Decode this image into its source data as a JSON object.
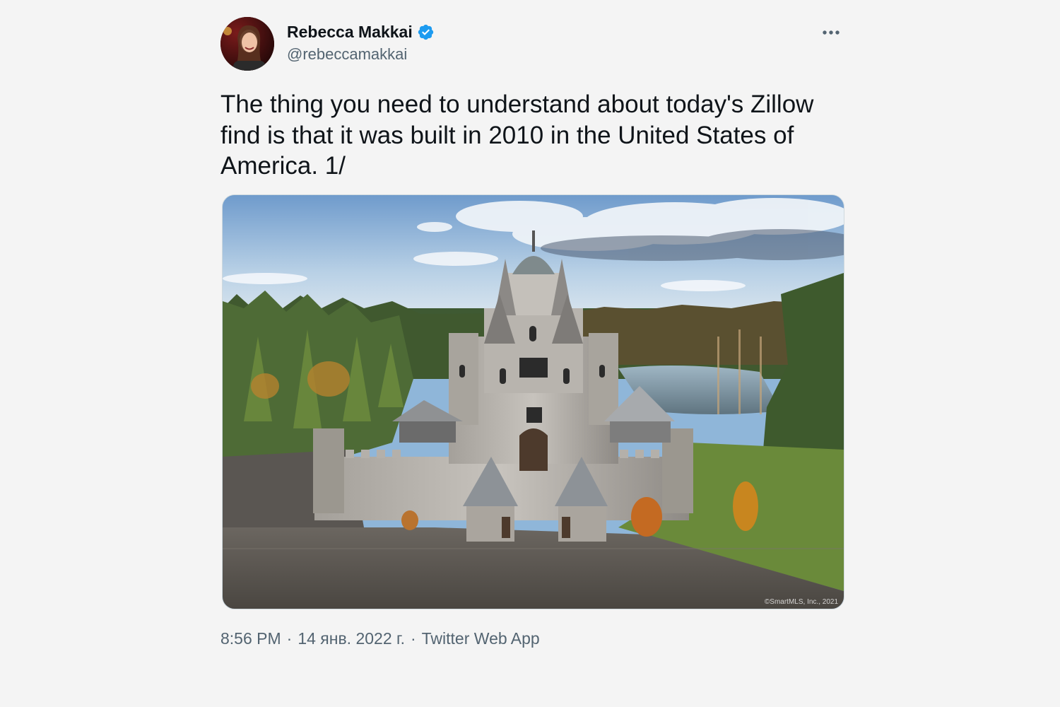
{
  "author": {
    "name": "Rebecca Makkai",
    "handle": "@rebeccamakkai",
    "verified_icon": "verified-badge-icon",
    "accent_color": "#1d9bf0"
  },
  "menu_icon": "more-horizontal-icon",
  "tweet": {
    "text": "The thing you need to understand about today's Zillow find is that it was built in 2010 in the United States of America. 1/",
    "media_credit": "©SmartMLS, Inc., 2021"
  },
  "meta": {
    "time": "8:56 PM",
    "separator": "·",
    "date": "14 янв. 2022 г.",
    "source": "Twitter Web App"
  }
}
